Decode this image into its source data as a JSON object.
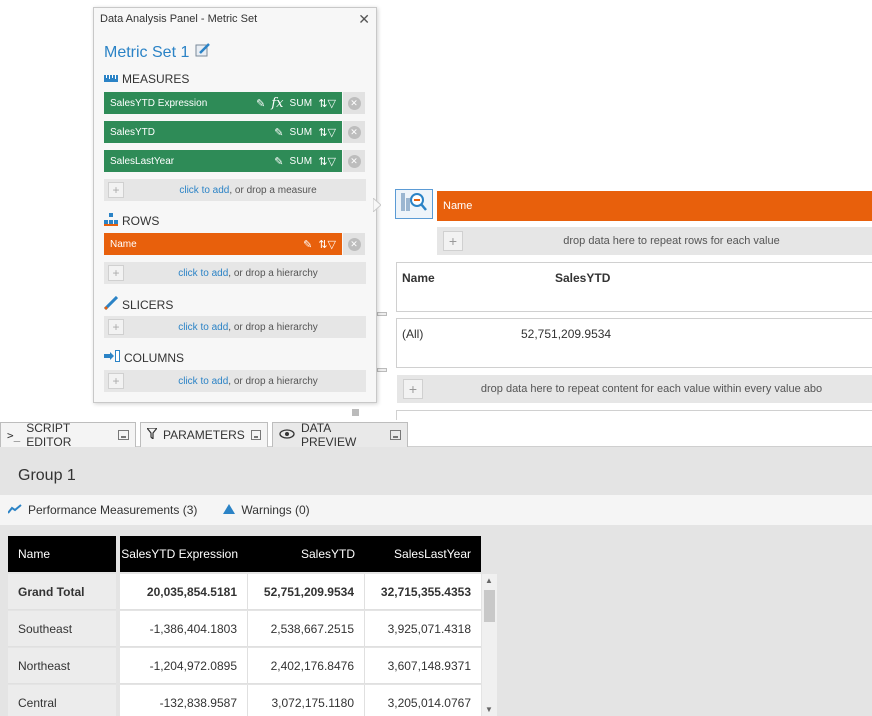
{
  "panel": {
    "title": "Data Analysis Panel - Metric Set",
    "metric_set_name": "Metric Set 1",
    "measures_label": "MEASURES",
    "measures": [
      {
        "label": "SalesYTD Expression",
        "agg": "SUM",
        "has_fx": true
      },
      {
        "label": "SalesYTD",
        "agg": "SUM",
        "has_fx": false
      },
      {
        "label": "SalesLastYear",
        "agg": "SUM",
        "has_fx": false
      }
    ],
    "measure_drop": {
      "link": "click to add",
      "rest": ", or drop a measure"
    },
    "rows_label": "ROWS",
    "rows": [
      {
        "label": "Name"
      }
    ],
    "rows_drop": {
      "link": "click to add",
      "rest": ", or drop a hierarchy"
    },
    "slicers_label": "SLICERS",
    "slicers_drop": {
      "link": "click to add",
      "rest": ", or drop a hierarchy"
    },
    "columns_label": "COLUMNS",
    "columns_drop": {
      "link": "click to add",
      "rest": ", or drop a hierarchy"
    }
  },
  "canvas": {
    "row_header": "Name",
    "repeat_rows_text": "drop data here to repeat rows for each value",
    "grid_headers": [
      "Name",
      "SalesYTD"
    ],
    "grid_row": [
      "(All)",
      "52,751,209.9534"
    ],
    "repeat_content_text": "drop data here to repeat content for each value within every value abo"
  },
  "tabs": [
    {
      "label": "SCRIPT EDITOR",
      "icon": "terminal-icon"
    },
    {
      "label": "PARAMETERS",
      "icon": "filter-icon"
    },
    {
      "label": "DATA PREVIEW",
      "icon": "eye-icon"
    }
  ],
  "preview": {
    "group_title": "Group 1",
    "performance_label": "Performance Measurements (3)",
    "warnings_label": "Warnings (0)",
    "columns": [
      "Name",
      "SalesYTD Expression",
      "SalesYTD",
      "SalesLastYear"
    ],
    "rows": [
      [
        "Grand Total",
        "20,035,854.5181",
        "52,751,209.9534",
        "32,715,355.4353"
      ],
      [
        "Southeast",
        "-1,386,404.1803",
        "2,538,667.2515",
        "3,925,071.4318"
      ],
      [
        "Northeast",
        "-1,204,972.0895",
        "2,402,176.8476",
        "3,607,148.9371"
      ],
      [
        "Central",
        "-132,838.9587",
        "3,072,175.1180",
        "3,205,014.0767"
      ]
    ]
  },
  "colors": {
    "measure_green": "#2e8b57",
    "row_orange": "#e8600c",
    "link_blue": "#2b83c6"
  }
}
